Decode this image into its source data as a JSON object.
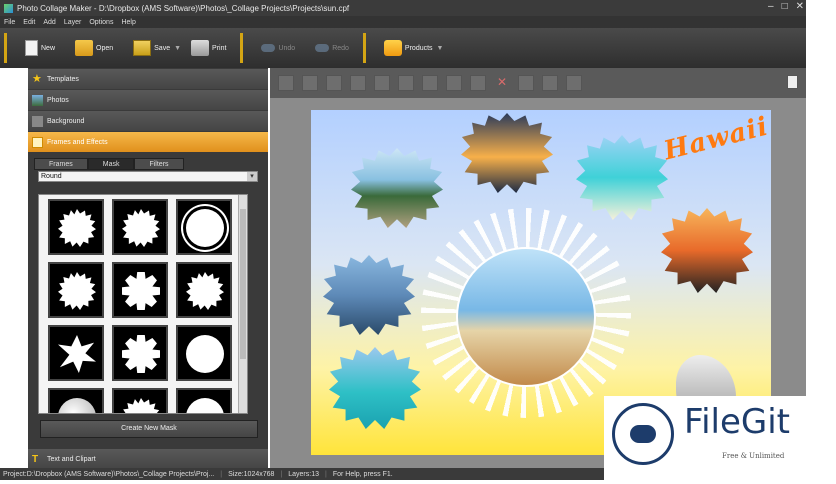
{
  "window": {
    "title": "Photo Collage Maker - D:\\Dropbox (AMS Software)\\Photos\\_Collage Projects\\Projects\\sun.cpf",
    "minimize": "–",
    "maximize": "□",
    "close": "✕"
  },
  "menu": [
    "File",
    "Edit",
    "Add",
    "Layer",
    "Options",
    "Help"
  ],
  "toolbar": {
    "new": "New",
    "open": "Open",
    "save": "Save",
    "print": "Print",
    "undo": "Undo",
    "redo": "Redo",
    "products": "Products"
  },
  "sidebar": {
    "sections": [
      "Templates",
      "Photos",
      "Background",
      "Frames and Effects"
    ],
    "tabs": [
      "Frames",
      "Mask",
      "Filters"
    ],
    "active_tab": "Mask",
    "mask_type": "Round",
    "create_mask": "Create New Mask",
    "text_section": "Text and Clipart"
  },
  "canvas": {
    "heading": "Hawaii"
  },
  "watermark": {
    "name": "FileGit",
    "tagline": "Free & Unlimited"
  },
  "status": {
    "project": "Project:D:\\Dropbox (AMS Software)\\Photos\\_Collage Projects\\Proj...",
    "size": "Size:1024x768",
    "layers": "Layers:13",
    "help": "For Help, press F1."
  },
  "colors": {
    "accent": "#e0901c",
    "toolbar_separator": "#d4a514",
    "heading": "#ff7a10",
    "filegit": "#1d3c6b"
  }
}
